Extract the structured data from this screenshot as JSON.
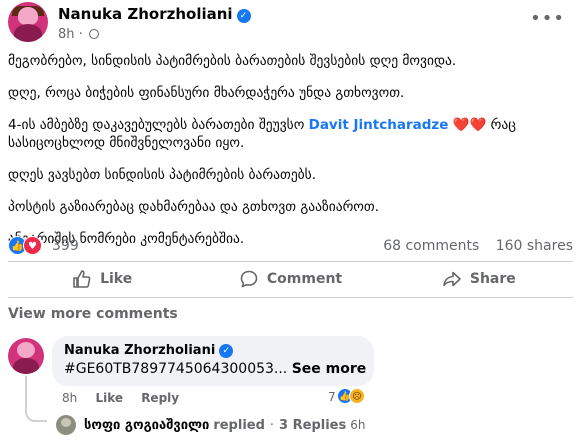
{
  "post": {
    "author": "Nanuka Zhorzholiani",
    "time": "8h",
    "separator": "·",
    "paragraphs": [
      "მეგობრებო, სინდისის პატიმრების ბარათების შევსების დღე მოვიდა.",
      "დღე, როცა ბიჭების ფინანსური მხარდაჭერა უნდა გთხოვოთ.",
      "დღეს ვავსებთ სინდისის პატიმრების ბარათებს.",
      "პოსტის გაზიარებაც დახმარებაა და გთხოვთ გააზიაროთ.",
      "ანგარიშის ნომრები კომენტარებშია."
    ],
    "paragraph3_pre": "4-ის ამბებზე დაკავებულებს ბარათები შეუვსო",
    "mention": "Davit Jintcharadze",
    "hearts": "❤️❤️",
    "paragraph3_post": "რაც სასიცოცხლოდ მნიშვნელოვანი იყო."
  },
  "stats": {
    "reactions": "399",
    "comments": "68 comments",
    "shares": "160 shares"
  },
  "actions": {
    "like": "Like",
    "comment": "Comment",
    "share": "Share"
  },
  "comments": {
    "view_more": "View more comments",
    "first": {
      "author": "Nanuka Zhorzholiani",
      "text": "#GE60TB7897745064300053...",
      "see_more": "See more",
      "time": "8h",
      "like": "Like",
      "reply": "Reply",
      "reaction_count": "7"
    },
    "reply_summary": {
      "name": "სოფი გოგიაშვილი",
      "action": "replied",
      "separator": "·",
      "count": "3 Replies",
      "time": "6h"
    }
  },
  "icons": {
    "verified": "verified-badge-icon",
    "globe": "globe-icon",
    "more": "more-options-icon",
    "like": "thumbs-up-icon",
    "love": "heart-icon",
    "comment": "speech-bubble-icon",
    "share": "share-arrow-icon",
    "sad": "sad-face-icon"
  },
  "colors": {
    "accent": "#1877f2",
    "love": "#f02849",
    "secondary_text": "#65676b",
    "bubble": "#f0f2f5"
  }
}
